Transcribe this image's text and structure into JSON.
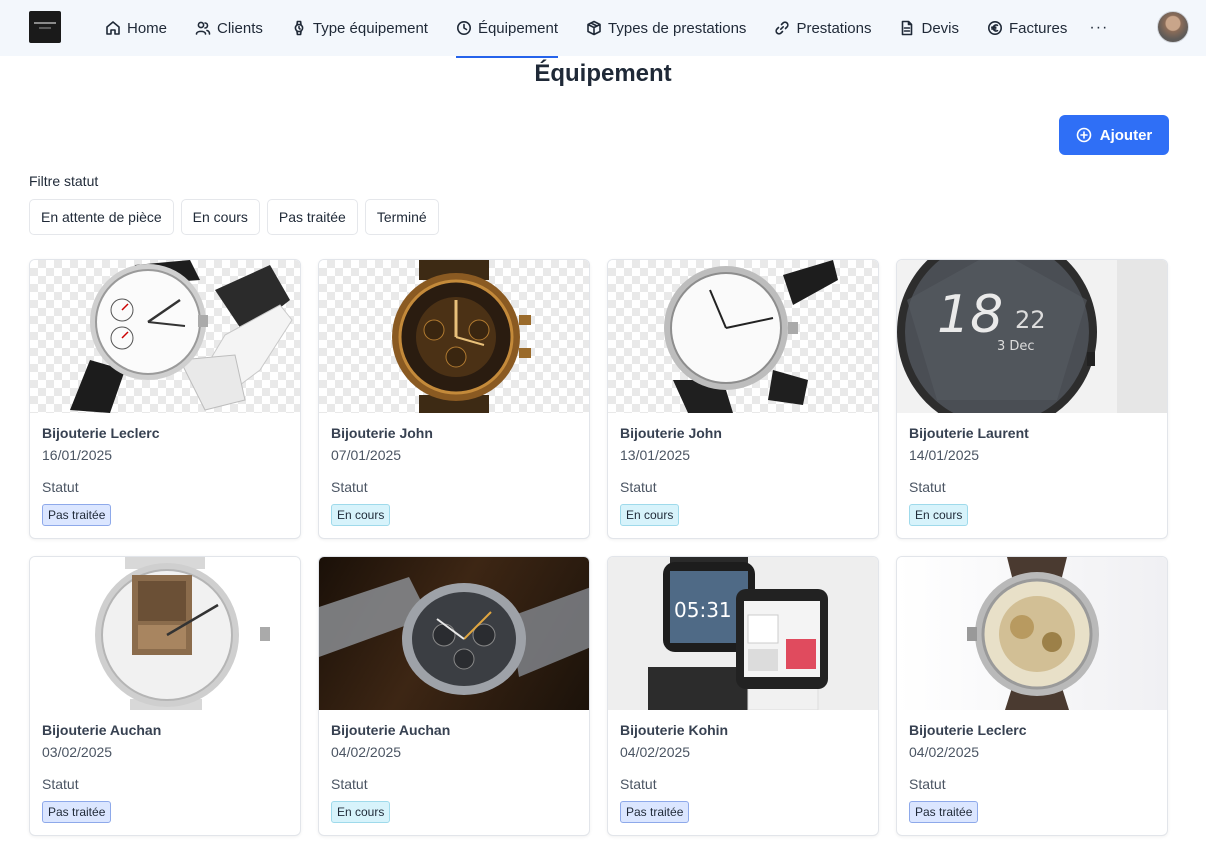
{
  "nav": {
    "items": [
      {
        "label": "Home",
        "icon": "home-icon",
        "active": false
      },
      {
        "label": "Clients",
        "icon": "users-icon",
        "active": false
      },
      {
        "label": "Type équipement",
        "icon": "watch-icon",
        "active": false
      },
      {
        "label": "Équipement",
        "icon": "clock-icon",
        "active": true
      },
      {
        "label": "Types de prestations",
        "icon": "box-icon",
        "active": false
      },
      {
        "label": "Prestations",
        "icon": "link-icon",
        "active": false
      },
      {
        "label": "Devis",
        "icon": "file-icon",
        "active": false
      },
      {
        "label": "Factures",
        "icon": "euro-icon",
        "active": false
      }
    ],
    "more": "···"
  },
  "page": {
    "title": "Équipement",
    "add_label": "Ajouter",
    "filter_label": "Filtre statut"
  },
  "filters": [
    "En attente de pièce",
    "En cours",
    "Pas traitée",
    "Terminé"
  ],
  "cards": [
    {
      "shop": "Bijouterie Leclerc",
      "date": "16/01/2025",
      "status_label": "Statut",
      "status": "Pas traitée",
      "status_kind": "pas",
      "image": "chronograph-white-dial-watch"
    },
    {
      "shop": "Bijouterie John",
      "date": "07/01/2025",
      "status_label": "Statut",
      "status": "En cours",
      "status_kind": "cours",
      "image": "bronze-skeleton-watch"
    },
    {
      "shop": "Bijouterie John",
      "date": "13/01/2025",
      "status_label": "Statut",
      "status": "En cours",
      "status_kind": "cours",
      "image": "minimal-white-dial-watch"
    },
    {
      "shop": "Bijouterie Laurent",
      "date": "14/01/2025",
      "status_label": "Statut",
      "status": "En cours",
      "status_kind": "cours",
      "image": "round-smartwatch"
    },
    {
      "shop": "Bijouterie Auchan",
      "date": "03/02/2025",
      "status_label": "Statut",
      "status": "Pas traitée",
      "status_kind": "pas",
      "image": "picture-dial-watch"
    },
    {
      "shop": "Bijouterie Auchan",
      "date": "04/02/2025",
      "status_label": "Statut",
      "status": "En cours",
      "status_kind": "cours",
      "image": "steel-chronograph-photo"
    },
    {
      "shop": "Bijouterie Kohin",
      "date": "04/02/2025",
      "status_label": "Statut",
      "status": "Pas traitée",
      "status_kind": "pas",
      "image": "square-smartwatches"
    },
    {
      "shop": "Bijouterie Leclerc",
      "date": "04/02/2025",
      "status_label": "Statut",
      "status": "Pas traitée",
      "status_kind": "pas",
      "image": "open-caseback-watch"
    }
  ],
  "watch_texts": {
    "smartwatch_hour": "18",
    "smartwatch_min": "22",
    "smartwatch_date": "3 Dec",
    "square_time": "05:31"
  },
  "colors": {
    "accent": "#2f6ff6",
    "badge_pas": "#dbe6ff",
    "badge_cours": "#d7f3fb"
  }
}
